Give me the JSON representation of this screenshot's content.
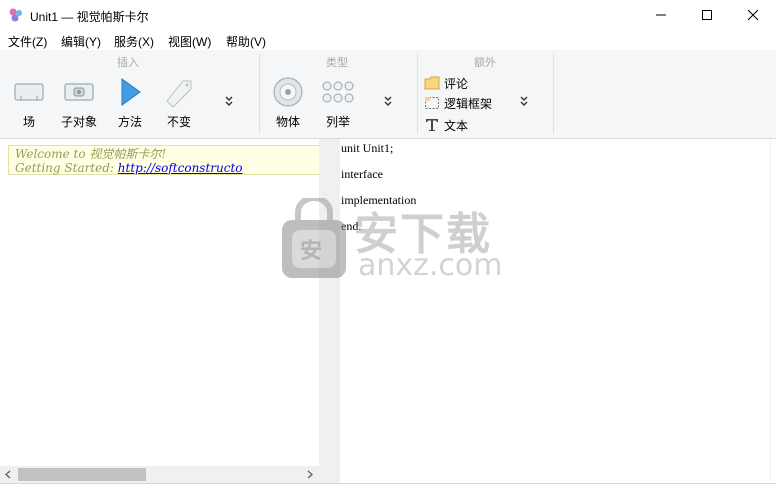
{
  "window": {
    "title": "Unit1 — 视觉帕斯卡尔"
  },
  "menu": [
    "文件(Z)",
    "编辑(Y)",
    "服务(X)",
    "视图(W)",
    "帮助(V)"
  ],
  "ribbon": {
    "groups": {
      "insert": "插入",
      "type": "类型",
      "extra": "额外"
    },
    "insert_buttons": [
      "场",
      "子对象",
      "方法",
      "不变"
    ],
    "type_buttons": [
      "物体",
      "列举"
    ],
    "extra_buttons": [
      "评论",
      "逻辑框架",
      "文本"
    ]
  },
  "welcome": {
    "line1": "Welcome to 视觉帕斯卡尔!",
    "line2_prefix": "Getting Started: ",
    "link": "http://softconstructo"
  },
  "code": [
    "unit Unit1;",
    "interface",
    "implementation",
    "end."
  ],
  "watermark": {
    "text1": "安下载",
    "text2": "anxz.com",
    "shield": "安"
  },
  "colors": {
    "ribbon_bg": "#f5f6f7",
    "welcome_bg": "#ffffe4",
    "link": "#0000ee",
    "play_blue": "#3f9ee6"
  }
}
